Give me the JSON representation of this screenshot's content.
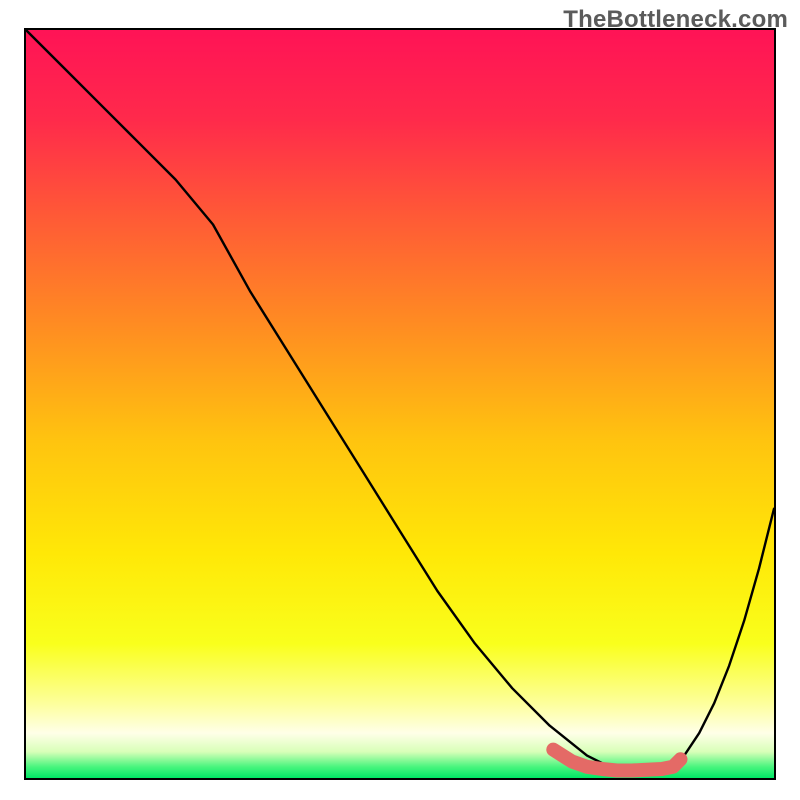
{
  "watermark": "TheBottleneck.com",
  "chart_data": {
    "type": "line",
    "title": "",
    "xlabel": "",
    "ylabel": "",
    "xlim": [
      0,
      100
    ],
    "ylim": [
      0,
      100
    ],
    "grid": false,
    "series": [
      {
        "name": "bottleneck-curve",
        "color": "#000000",
        "x": [
          0,
          5,
          10,
          15,
          20,
          25,
          30,
          35,
          40,
          45,
          50,
          55,
          60,
          65,
          70,
          75,
          78,
          80,
          82,
          84,
          86,
          88,
          90,
          92,
          94,
          96,
          98,
          100
        ],
        "y": [
          100,
          95,
          90,
          85,
          80,
          74,
          65,
          57,
          49,
          41,
          33,
          25,
          18,
          12,
          7,
          3,
          1.5,
          1,
          1,
          1.2,
          1.5,
          3,
          6,
          10,
          15,
          21,
          28,
          36
        ]
      }
    ],
    "highlight": {
      "name": "salmon-band",
      "color": "#e46a66",
      "x": [
        70.5,
        73,
        75,
        77,
        79,
        81,
        83,
        85,
        86.5,
        87.5
      ],
      "y": [
        3.8,
        2.2,
        1.5,
        1.2,
        1.0,
        1.0,
        1.1,
        1.2,
        1.5,
        2.5
      ]
    },
    "background_gradient": {
      "stops": [
        {
          "pos": 0.0,
          "color": "#ff1356"
        },
        {
          "pos": 0.12,
          "color": "#ff2a4b"
        },
        {
          "pos": 0.25,
          "color": "#ff5a36"
        },
        {
          "pos": 0.4,
          "color": "#ff8e21"
        },
        {
          "pos": 0.55,
          "color": "#ffc40f"
        },
        {
          "pos": 0.7,
          "color": "#ffe807"
        },
        {
          "pos": 0.82,
          "color": "#f9ff1c"
        },
        {
          "pos": 0.9,
          "color": "#fdff9b"
        },
        {
          "pos": 0.94,
          "color": "#ffffe8"
        },
        {
          "pos": 0.965,
          "color": "#d8ffb8"
        },
        {
          "pos": 0.985,
          "color": "#49f57e"
        },
        {
          "pos": 1.0,
          "color": "#00e765"
        }
      ]
    }
  }
}
